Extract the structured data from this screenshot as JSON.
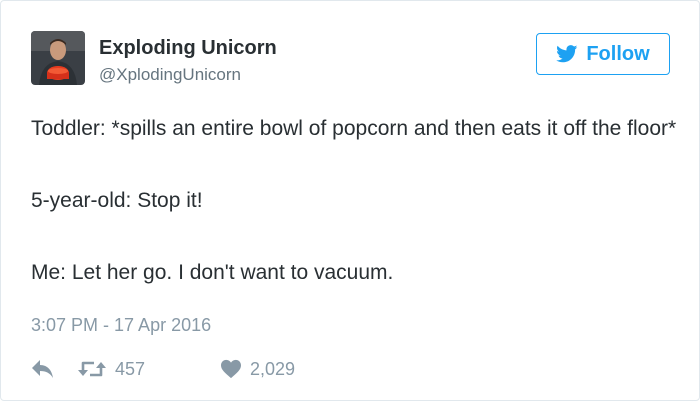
{
  "user": {
    "display_name": "Exploding Unicorn",
    "handle": "@XplodingUnicorn",
    "avatar_icon": "user-avatar-photo"
  },
  "follow": {
    "label": "Follow",
    "icon": "twitter-bird-icon",
    "color": "#1da1f2"
  },
  "tweet": {
    "lines": [
      "Toddler: *spills an entire bowl of popcorn and then eats it off the floor*",
      "5-year-old: Stop it!",
      "Me: Let her go. I don't want to vacuum."
    ],
    "timestamp": "3:07 PM - 17 Apr 2016"
  },
  "actions": {
    "reply_icon": "reply-icon",
    "retweet_icon": "retweet-icon",
    "retweet_count": "457",
    "like_icon": "heart-icon",
    "like_count": "2,029"
  },
  "colors": {
    "text": "#292f33",
    "secondary": "#66757f",
    "muted": "#8899a6",
    "border": "#e1e8ed"
  }
}
